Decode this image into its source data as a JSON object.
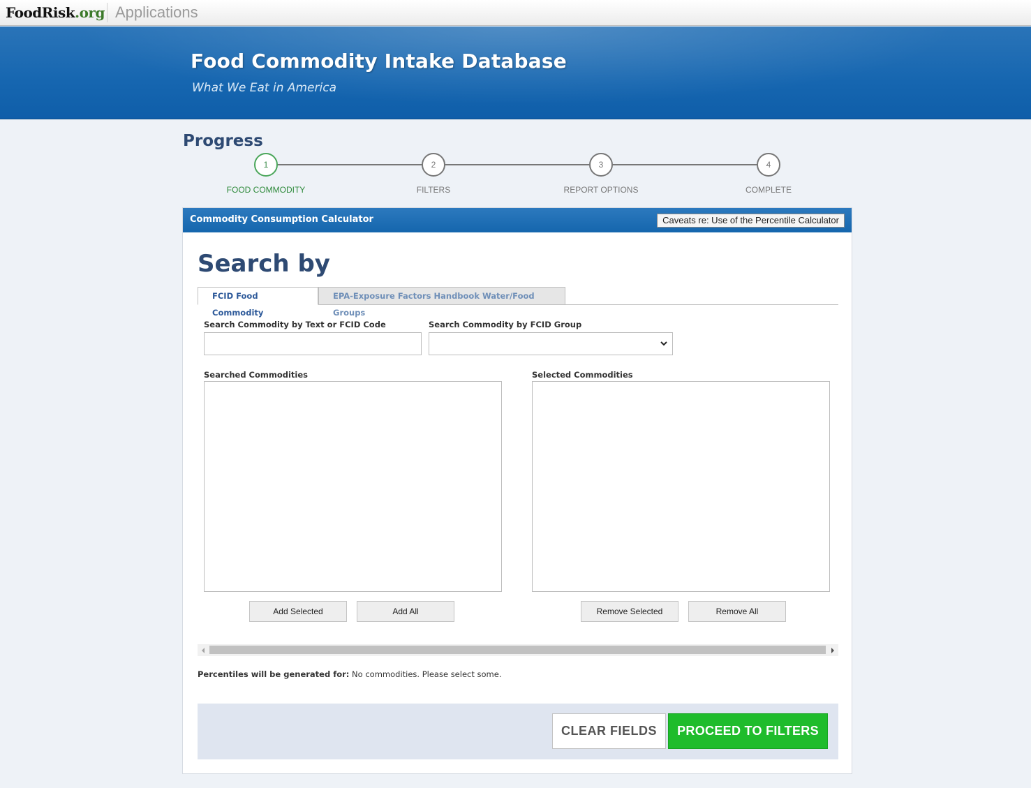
{
  "topbar": {
    "logo_main": "FoodRisk",
    "logo_tld": ".org",
    "applications_label": "Applications"
  },
  "banner": {
    "title": "Food Commodity Intake Database",
    "subtitle": "What We Eat in America"
  },
  "progress": {
    "title": "Progress",
    "steps": [
      {
        "number": "1",
        "label": "FOOD COMMODITY",
        "active": true
      },
      {
        "number": "2",
        "label": "FILTERS",
        "active": false
      },
      {
        "number": "3",
        "label": "REPORT OPTIONS",
        "active": false
      },
      {
        "number": "4",
        "label": "COMPLETE",
        "active": false
      }
    ]
  },
  "panel": {
    "header_title": "Commodity Consumption Calculator",
    "caveat_button": "Caveats re: Use of the Percentile Calculator",
    "search_heading": "Search by",
    "tabs": [
      {
        "label": "FCID Food Commodity",
        "active": true
      },
      {
        "label": "EPA-Exposure Factors Handbook Water/Food Groups",
        "active": false
      }
    ],
    "search_text_label": "Search Commodity by Text or FCID Code",
    "search_text_value": "",
    "search_group_label": "Search Commodity by FCID Group",
    "search_group_value": "",
    "searched_label": "Searched Commodities",
    "selected_label": "Selected Commodities",
    "add_selected": "Add Selected",
    "add_all": "Add All",
    "remove_selected": "Remove Selected",
    "remove_all": "Remove All",
    "percentiles_prefix": "Percentiles will be generated for:",
    "percentiles_value": "No commodities. Please select some.",
    "clear_button": "CLEAR FIELDS",
    "proceed_button": "PROCEED TO FILTERS"
  },
  "colors": {
    "banner_blue": "#1666b0",
    "heading_navy": "#2e4a73",
    "active_green": "#2e8a3b",
    "proceed_green": "#1fbc2c"
  }
}
